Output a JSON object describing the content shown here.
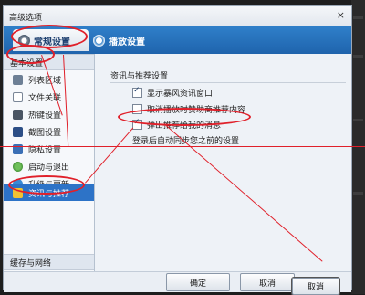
{
  "window": {
    "title": "高级选项",
    "close_glyph": "×"
  },
  "tabs": [
    {
      "label": "常规设置",
      "icon": "gear-icon",
      "active": true
    },
    {
      "label": "播放设置",
      "icon": "play-icon",
      "active": false
    }
  ],
  "sidebar": {
    "group_basic": "基本设置",
    "items": [
      {
        "label": "列表区域",
        "icon": "list-icon"
      },
      {
        "label": "文件关联",
        "icon": "file-icon"
      },
      {
        "label": "热键设置",
        "icon": "hotkey-icon"
      },
      {
        "label": "截图设置",
        "icon": "screenshot-icon"
      },
      {
        "label": "隐私设置",
        "icon": "privacy-icon"
      },
      {
        "label": "启动与退出",
        "icon": "power-icon"
      },
      {
        "label": "升级与更新",
        "icon": "update-icon"
      },
      {
        "label": "资讯与推荐",
        "icon": "news-icon",
        "selected": true
      }
    ],
    "group_cache": "缓存与网络"
  },
  "content": {
    "section_title": "资讯与推荐设置",
    "options": [
      {
        "label": "显示暴风资讯窗口",
        "checked": true
      },
      {
        "label": "取消播放时赞助商推荐内容",
        "checked": false
      },
      {
        "label": "弹出推荐给我的消息",
        "checked": true
      }
    ],
    "note": "登录后自动同步您之前的设置"
  },
  "buttons": {
    "ok": "确定",
    "cancel": "取消",
    "cancel_overlay": "取消"
  },
  "colors": {
    "annotation": "#e0202a",
    "accent": "#2d73c7",
    "tab_bar": "#1f64ad"
  }
}
